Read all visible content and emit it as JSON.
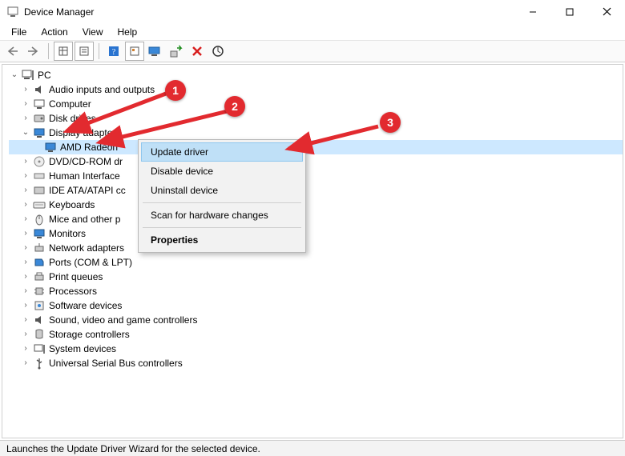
{
  "window": {
    "title": "Device Manager"
  },
  "menu": {
    "file": "File",
    "action": "Action",
    "view": "View",
    "help": "Help"
  },
  "tree": {
    "root": "PC",
    "items": [
      "Audio inputs and outputs",
      "Computer",
      "Disk drives",
      "Display adapters",
      "AMD Radeon",
      "DVD/CD-ROM dr",
      "Human Interface",
      "IDE ATA/ATAPI cc",
      "Keyboards",
      "Mice and other p",
      "Monitors",
      "Network adapters",
      "Ports (COM & LPT)",
      "Print queues",
      "Processors",
      "Software devices",
      "Sound, video and game controllers",
      "Storage controllers",
      "System devices",
      "Universal Serial Bus controllers"
    ]
  },
  "context_menu": {
    "update": "Update driver",
    "disable": "Disable device",
    "uninstall": "Uninstall device",
    "scan": "Scan for hardware changes",
    "properties": "Properties"
  },
  "status": "Launches the Update Driver Wizard for the selected device.",
  "badges": {
    "b1": "1",
    "b2": "2",
    "b3": "3"
  }
}
